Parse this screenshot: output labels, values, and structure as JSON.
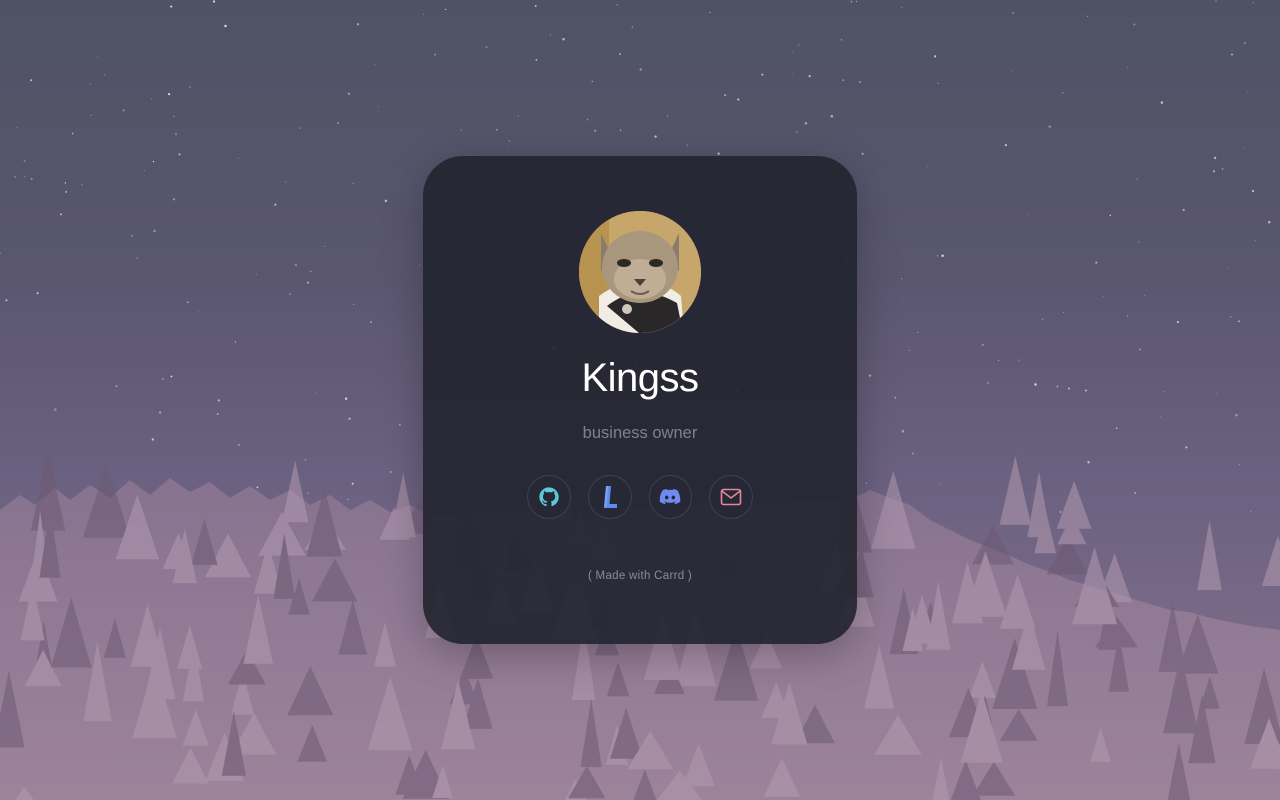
{
  "profile": {
    "name": "Kingss",
    "tagline": "business owner"
  },
  "socials": [
    {
      "icon": "github-icon",
      "color": "#5ec8d6"
    },
    {
      "icon": "letterboxd-l-icon",
      "color": "#5e8df0"
    },
    {
      "icon": "discord-icon",
      "color": "#6f8bf0"
    },
    {
      "icon": "mail-icon",
      "color": "#e5859d"
    }
  ],
  "footer": {
    "credit": "( Made with Carrd )"
  },
  "colors": {
    "card_background": "#242530",
    "name_text": "#ffffff",
    "tagline_text": "#7f8090"
  }
}
